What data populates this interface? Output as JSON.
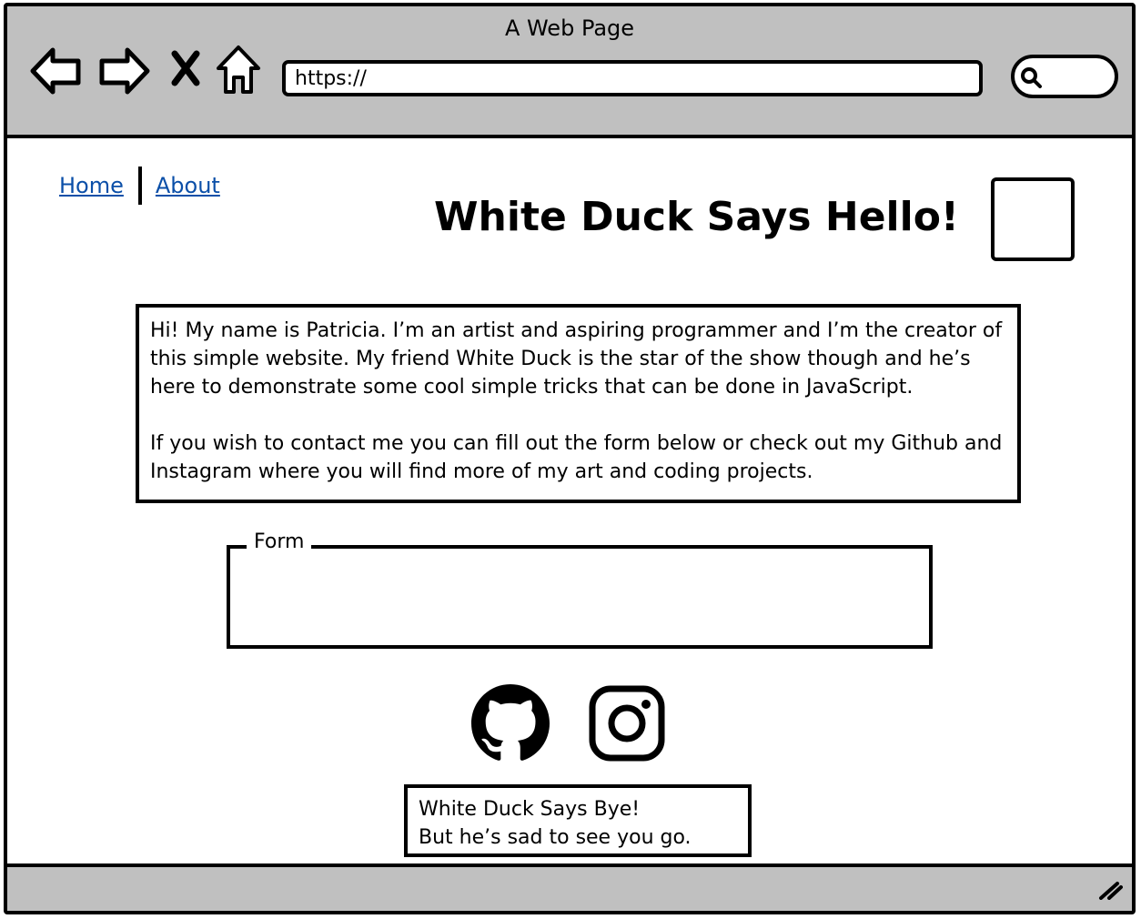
{
  "window": {
    "title": "A Web Page"
  },
  "toolbar": {
    "back_icon": "back-arrow-icon",
    "forward_icon": "forward-arrow-icon",
    "stop_icon": "close-icon",
    "home_icon": "home-icon",
    "url_value": "https://",
    "search_icon": "search-icon"
  },
  "nav": {
    "home_label": "Home",
    "about_label": "About"
  },
  "header": {
    "title": "White Duck Says Hello!"
  },
  "intro": {
    "paragraph1": "Hi! My name is Patricia. I’m an artist and aspiring programmer and I’m the creator of this simple website. My friend White Duck is the star of the show though and he’s here to demonstrate some cool simple tricks that can be done in JavaScript.",
    "paragraph2": "If you wish to contact me you can fill out the form below or check out my Github and Instagram where you will find more of my art and coding projects."
  },
  "form": {
    "legend": "Form"
  },
  "social": {
    "github_icon": "github-icon",
    "instagram_icon": "instagram-icon"
  },
  "footer": {
    "line1": "White Duck Says Bye!",
    "line2": "But he’s sad to see you go."
  },
  "colors": {
    "chrome": "#c0c0c0",
    "link": "#0b4fa8",
    "border": "#000000",
    "background": "#ffffff"
  }
}
